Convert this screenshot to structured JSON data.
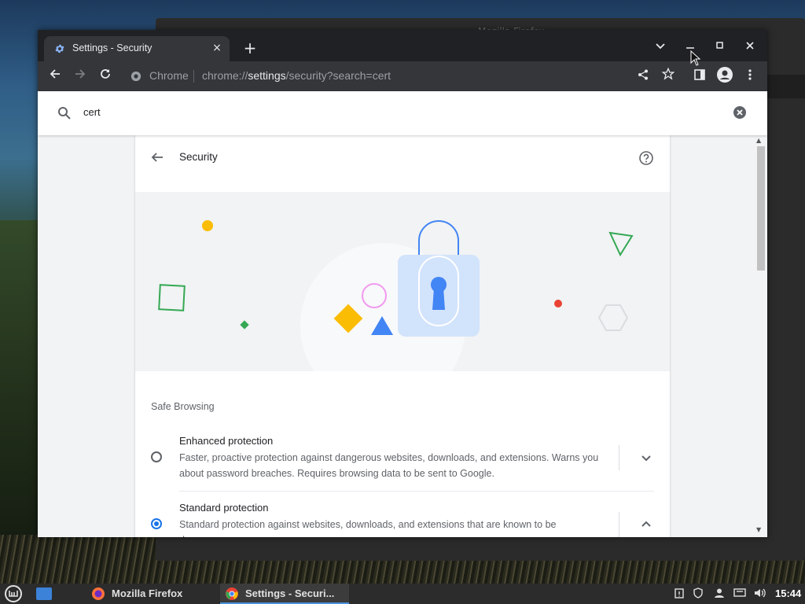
{
  "background_window": {
    "title": "Mozilla Firefox"
  },
  "browser": {
    "tab_title": "Settings - Security",
    "tab_close": "×",
    "new_tab": "+",
    "omnibox": {
      "chip": "Chrome",
      "url_prefix": "chrome://",
      "url_highlight": "settings",
      "url_suffix": "/security?search=cert"
    }
  },
  "settings": {
    "search_value": "cert",
    "page_title": "Security",
    "section_title": "Safe Browsing",
    "options": [
      {
        "label": "Enhanced protection",
        "description": "Faster, proactive protection against dangerous websites, downloads, and extensions. Warns you about password breaches. Requires browsing data to be sent to Google.",
        "selected": false,
        "expanded": false
      },
      {
        "label": "Standard protection",
        "description": "Standard protection against websites, downloads, and extensions that are known to be dangerous.",
        "selected": true,
        "expanded": true
      }
    ]
  },
  "taskbar": {
    "tasks": [
      {
        "label": "Mozilla Firefox",
        "icon": "firefox-icon",
        "active": false
      },
      {
        "label": "Settings - Securi...",
        "icon": "chrome-icon",
        "active": true
      }
    ],
    "clock": "15:44"
  },
  "colors": {
    "accent": "#1a73e8",
    "titlebar": "#202124",
    "toolbar": "#35363a",
    "taskbar": "#2c2c2c"
  }
}
